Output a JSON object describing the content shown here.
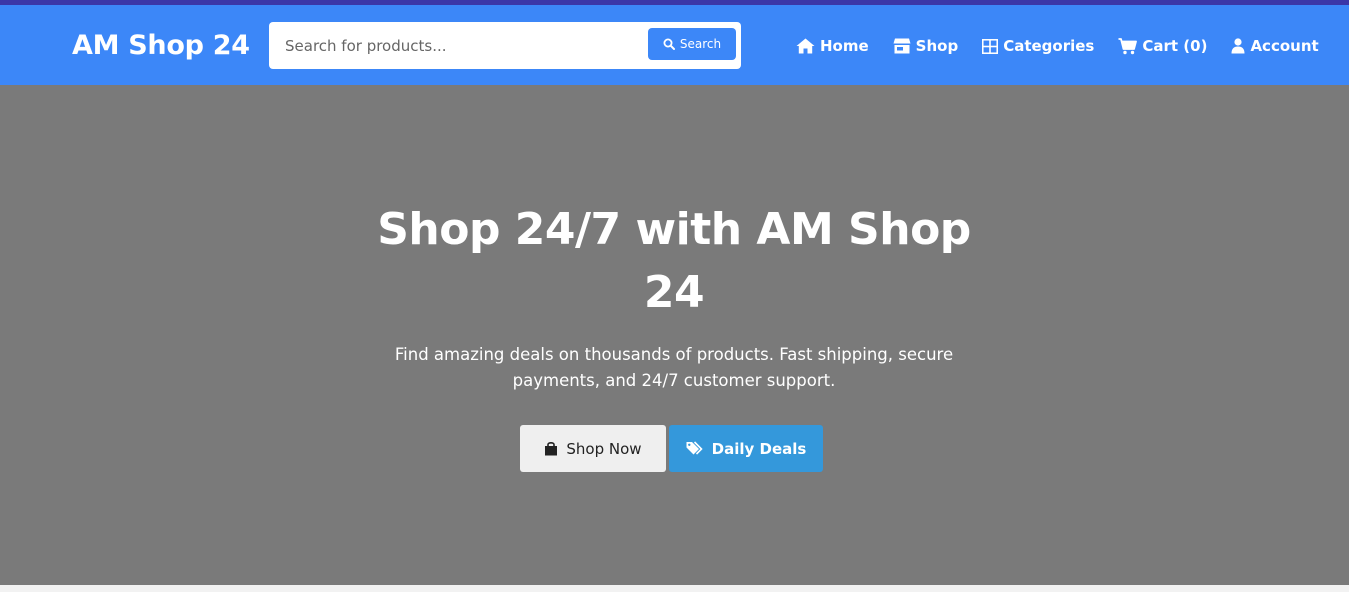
{
  "brand": {
    "name": "AM Shop 24"
  },
  "search": {
    "placeholder": "Search for products...",
    "value": "",
    "button_label": "Search",
    "icon": "search-icon"
  },
  "nav": {
    "items": [
      {
        "label": "Home",
        "icon": "home-icon"
      },
      {
        "label": "Shop",
        "icon": "store-icon"
      },
      {
        "label": "Categories",
        "icon": "grid-icon"
      },
      {
        "label": "Cart (0)",
        "icon": "cart-icon"
      },
      {
        "label": "Account",
        "icon": "user-icon"
      }
    ]
  },
  "hero": {
    "title": "Shop 24/7 with AM Shop 24",
    "subtitle": "Find amazing deals on thousands of products. Fast shipping, secure payments, and 24/7 customer support.",
    "primary_button": {
      "label": "Shop Now",
      "icon": "shopping-bag-icon"
    },
    "secondary_button": {
      "label": "Daily Deals",
      "icon": "tags-icon"
    }
  },
  "colors": {
    "accent": "#3c87f8",
    "top_strip": "#3b37a8",
    "hero_background": "#7a7a7a",
    "deals_button": "#3498db"
  }
}
